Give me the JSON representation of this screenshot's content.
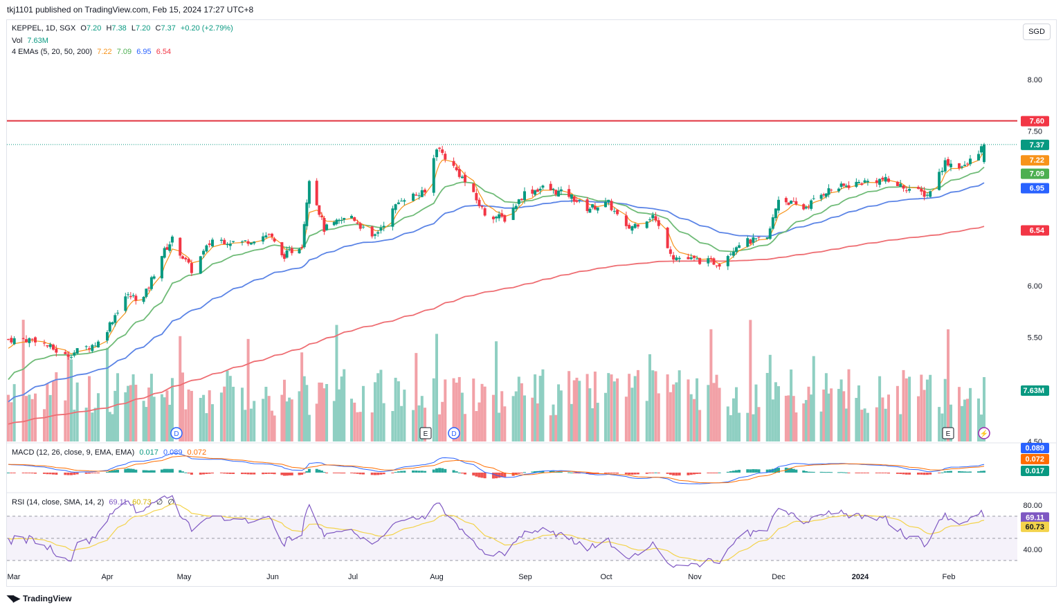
{
  "header": {
    "publish_line": "tkj1101 published on TradingView.com, Feb 15, 2024 17:27 UTC+8"
  },
  "currency_button": "SGD",
  "legend": {
    "symbol": "KEPPEL, 1D, SGX",
    "open_label": "O",
    "open": "7.20",
    "high_label": "H",
    "high": "7.38",
    "low_label": "L",
    "low": "7.20",
    "close_label": "C",
    "close": "7.37",
    "change": "+0.20 (+2.79%)",
    "vol_label": "Vol",
    "vol": "7.63M",
    "ema_label": "4 EMAs (5, 20, 50, 200)",
    "ema_values": [
      "7.22",
      "7.09",
      "6.95",
      "6.54"
    ],
    "macd_label": "MACD (12, 26, close, 9, EMA, EMA)",
    "macd_values": [
      "0.017",
      "0.089",
      "0.072"
    ],
    "rsi_label": "RSI (14, close, SMA, 14, 2)",
    "rsi_values": [
      "69.11",
      "60.73",
      "∅",
      "∅"
    ]
  },
  "colors": {
    "up": "#089981",
    "down": "#f23645",
    "vol_up": "#8fcfc2",
    "vol_down": "#f2a1a7",
    "ema5": "#f7931a",
    "ema20": "#6fbb77",
    "ema50": "#5b84e6",
    "ema200": "#ee6d72",
    "hline": "#e0323e",
    "macd": "#2962ff",
    "signal": "#ff6d00",
    "rsi": "#7e57c2",
    "rsi_ma": "#f3d34b"
  },
  "price_axis": {
    "ticks": [
      "8.00",
      "7.50",
      "6.00",
      "5.50",
      "4.50"
    ],
    "badges": [
      {
        "value": "7.60",
        "color": "#f23645"
      },
      {
        "value": "7.37",
        "color": "#089981"
      },
      {
        "value": "7.22",
        "color": "#f7931a"
      },
      {
        "value": "7.09",
        "color": "#4caf50"
      },
      {
        "value": "6.95",
        "color": "#2962ff"
      },
      {
        "value": "6.54",
        "color": "#f23645"
      },
      {
        "value": "7.63M",
        "color": "#089981"
      }
    ]
  },
  "macd_axis": {
    "badges": [
      {
        "value": "0.089",
        "color": "#2962ff"
      },
      {
        "value": "0.072",
        "color": "#ff6d00"
      },
      {
        "value": "0.017",
        "color": "#089981"
      }
    ]
  },
  "rsi_axis": {
    "ticks": [
      "80.00",
      "40.00"
    ],
    "badges": [
      {
        "value": "69.11",
        "color": "#7e57c2"
      },
      {
        "value": "60.73",
        "color": "#f3d34b"
      }
    ]
  },
  "time_axis": [
    "Mar",
    "Apr",
    "May",
    "Jun",
    "Jul",
    "Aug",
    "Sep",
    "Oct",
    "Nov",
    "Dec",
    "2024",
    "Feb"
  ],
  "event_markers": [
    "D",
    "E",
    "D",
    "E"
  ],
  "footer": {
    "brand": "TradingView"
  },
  "chart_data": {
    "type": "candlestick",
    "symbol": "KEPPEL, 1D, SGX",
    "horizontal_line": 7.6,
    "y_range": [
      4.5,
      8.3
    ],
    "last": {
      "open": 7.2,
      "high": 7.38,
      "low": 7.2,
      "close": 7.37,
      "volume": "7.63M"
    },
    "close_path": [
      {
        "date": "2023-03-01",
        "close": 5.48
      },
      {
        "date": "2023-03-10",
        "close": 5.48
      },
      {
        "date": "2023-03-20",
        "close": 5.32
      },
      {
        "date": "2023-03-31",
        "close": 5.45
      },
      {
        "date": "2023-04-10",
        "close": 5.9
      },
      {
        "date": "2023-04-17",
        "close": 5.88
      },
      {
        "date": "2023-04-24",
        "close": 6.3
      },
      {
        "date": "2023-04-28",
        "close": 6.45
      },
      {
        "date": "2023-05-05",
        "close": 6.15
      },
      {
        "date": "2023-05-12",
        "close": 6.45
      },
      {
        "date": "2023-05-22",
        "close": 6.42
      },
      {
        "date": "2023-05-31",
        "close": 6.5
      },
      {
        "date": "2023-06-05",
        "close": 6.28
      },
      {
        "date": "2023-06-13",
        "close": 6.4
      },
      {
        "date": "2023-06-16",
        "close": 7.05
      },
      {
        "date": "2023-06-22",
        "close": 6.55
      },
      {
        "date": "2023-07-03",
        "close": 6.68
      },
      {
        "date": "2023-07-10",
        "close": 6.45
      },
      {
        "date": "2023-07-20",
        "close": 6.85
      },
      {
        "date": "2023-07-28",
        "close": 6.9
      },
      {
        "date": "2023-08-01",
        "close": 7.35
      },
      {
        "date": "2023-08-10",
        "close": 7.05
      },
      {
        "date": "2023-08-18",
        "close": 6.7
      },
      {
        "date": "2023-08-25",
        "close": 6.65
      },
      {
        "date": "2023-09-01",
        "close": 6.9
      },
      {
        "date": "2023-09-08",
        "close": 6.95
      },
      {
        "date": "2023-09-18",
        "close": 6.88
      },
      {
        "date": "2023-09-25",
        "close": 6.75
      },
      {
        "date": "2023-10-03",
        "close": 6.8
      },
      {
        "date": "2023-10-09",
        "close": 6.55
      },
      {
        "date": "2023-10-18",
        "close": 6.68
      },
      {
        "date": "2023-10-25",
        "close": 6.28
      },
      {
        "date": "2023-11-01",
        "close": 6.25
      },
      {
        "date": "2023-11-10",
        "close": 6.22
      },
      {
        "date": "2023-11-17",
        "close": 6.42
      },
      {
        "date": "2023-11-27",
        "close": 6.45
      },
      {
        "date": "2023-12-01",
        "close": 6.85
      },
      {
        "date": "2023-12-11",
        "close": 6.75
      },
      {
        "date": "2023-12-20",
        "close": 6.92
      },
      {
        "date": "2024-01-02",
        "close": 7.0
      },
      {
        "date": "2024-01-10",
        "close": 7.03
      },
      {
        "date": "2024-01-18",
        "close": 6.95
      },
      {
        "date": "2024-01-25",
        "close": 6.88
      },
      {
        "date": "2024-01-31",
        "close": 7.2
      },
      {
        "date": "2024-02-07",
        "close": 7.15
      },
      {
        "date": "2024-02-14",
        "close": 7.37
      }
    ]
  }
}
